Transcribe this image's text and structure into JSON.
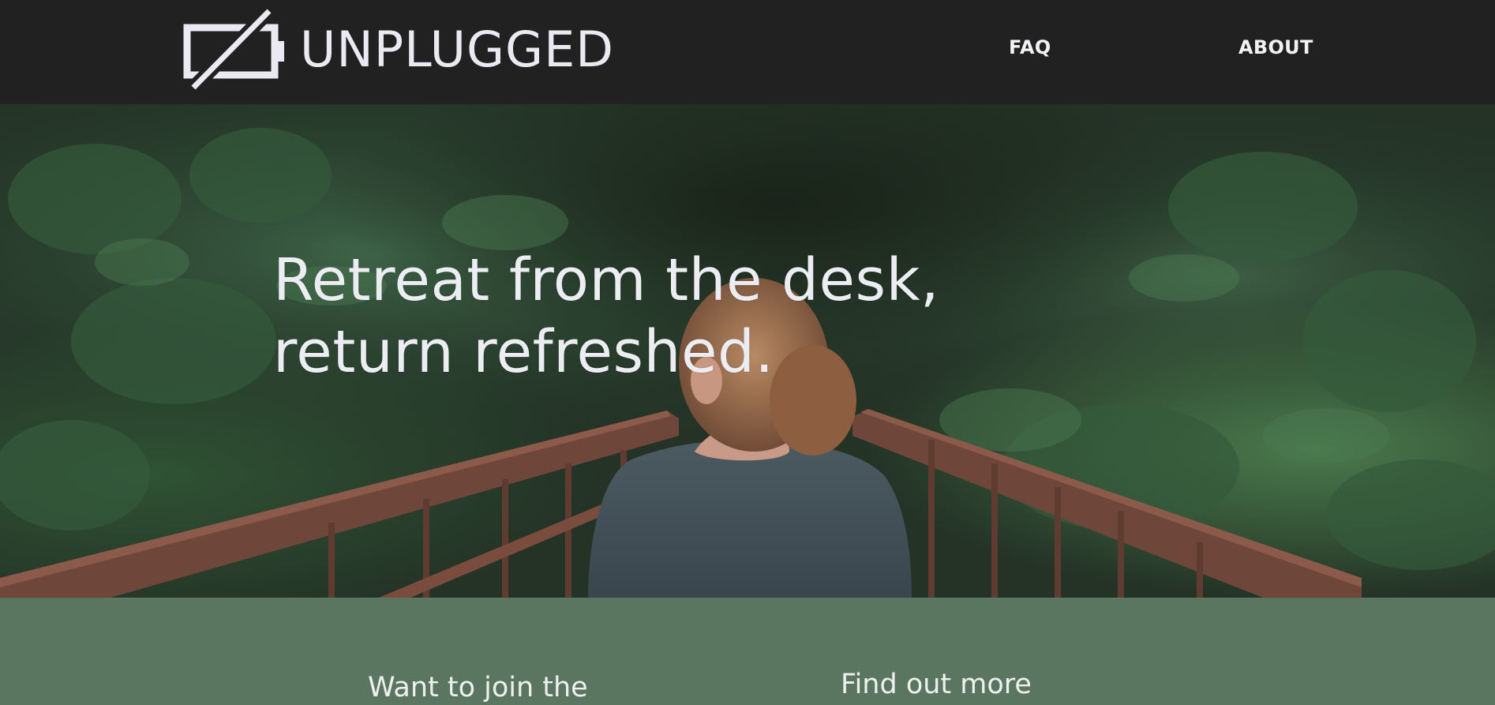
{
  "brand": {
    "name": "UNPLUGGED",
    "logo_icon": "battery-off-icon"
  },
  "nav": {
    "items": [
      {
        "label": "FAQ"
      },
      {
        "label": "ABOUT"
      }
    ]
  },
  "hero": {
    "title_line1": "Retreat from the desk,",
    "title_line2": "return refreshed.",
    "image": "forest-bridge-photo"
  },
  "info": {
    "join_heading": "Want to join the",
    "more_heading": "Find out more"
  },
  "colors": {
    "header_bg": "#212121",
    "header_text": "#ebeaf2",
    "section_green": "#5a7660",
    "hero_text": "#ececf3"
  }
}
